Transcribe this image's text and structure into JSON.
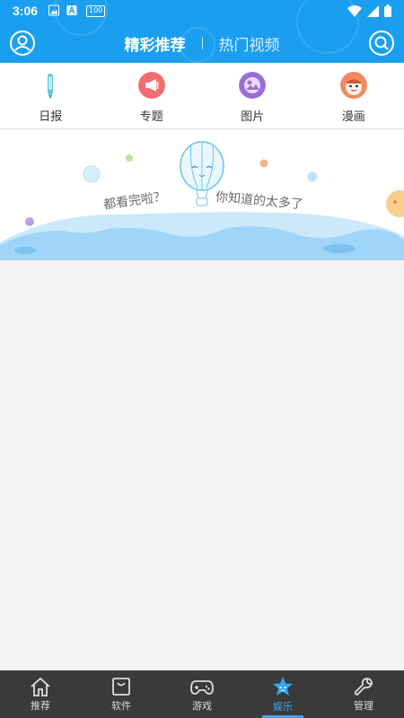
{
  "status_bar": {
    "time": "3:06",
    "badge_text": "100"
  },
  "header": {
    "tabs": [
      {
        "label": "精彩推荐",
        "active": true
      },
      {
        "label": "热门视频",
        "active": false
      }
    ],
    "left_icon": "user-icon",
    "right_icon": "search-icon",
    "color": "#1a9ff0"
  },
  "categories": [
    {
      "label": "日报",
      "icon": "pen-icon",
      "color": "#5fc6d8"
    },
    {
      "label": "专题",
      "icon": "megaphone-icon",
      "color": "#f26d72"
    },
    {
      "label": "图片",
      "icon": "image-icon",
      "color": "#9b6dd6"
    },
    {
      "label": "漫画",
      "icon": "face-icon",
      "color": "#f5885e"
    }
  ],
  "banner": {
    "text_left": "都看完啦？",
    "text_right": "你知道的太多了"
  },
  "bottom_nav": [
    {
      "label": "推荐",
      "icon": "home-icon",
      "active": false
    },
    {
      "label": "软件",
      "icon": "bag-icon",
      "active": false
    },
    {
      "label": "游戏",
      "icon": "gamepad-icon",
      "active": false
    },
    {
      "label": "娱乐",
      "icon": "star-icon",
      "active": true
    },
    {
      "label": "管理",
      "icon": "wrench-icon",
      "active": false
    }
  ],
  "active_color": "#37a6f5"
}
